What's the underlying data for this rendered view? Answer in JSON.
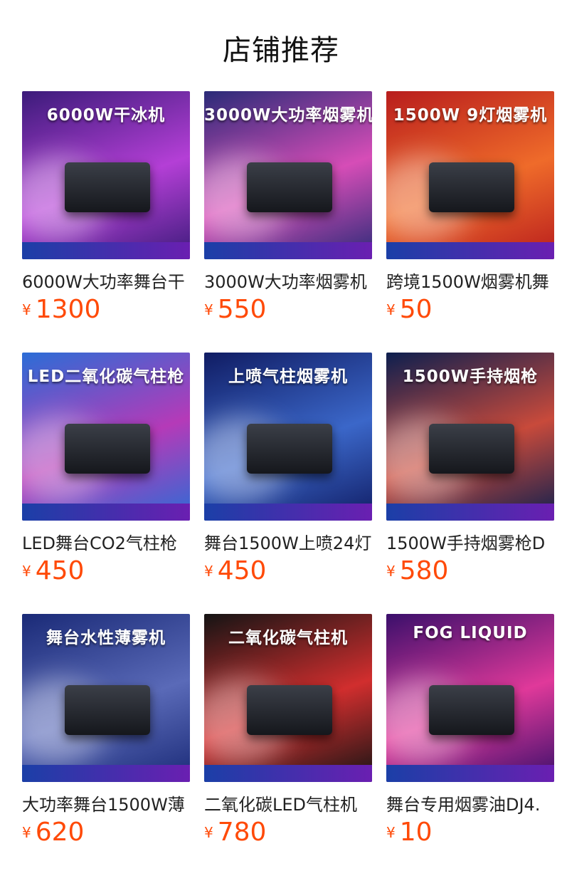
{
  "page": {
    "title": "店铺推荐"
  },
  "currency_symbol": "¥",
  "accent_color": "#ff4a08",
  "products": [
    {
      "name": "6000W大功率舞台干",
      "price": "1300",
      "image_headline": "6000W干冰机",
      "theme": [
        "#3b1b7a",
        "#b43fd6"
      ]
    },
    {
      "name": "3000W大功率烟雾机",
      "price": "550",
      "image_headline": "3000W大功率烟雾机",
      "theme": [
        "#2a2b78",
        "#d64db7"
      ]
    },
    {
      "name": "跨境1500W烟雾机舞",
      "price": "50",
      "image_headline": "1500W 9灯烟雾机",
      "theme": [
        "#b81d1d",
        "#ef6b2a"
      ]
    },
    {
      "name": "LED舞台CO2气柱枪",
      "price": "450",
      "image_headline": "LED二氧化碳气柱枪",
      "theme": [
        "#2b6dd6",
        "#b53ab8"
      ]
    },
    {
      "name": "舞台1500W上喷24灯",
      "price": "450",
      "image_headline": "上喷气柱烟雾机",
      "theme": [
        "#101c63",
        "#3b67c9"
      ]
    },
    {
      "name": "1500W手持烟雾枪D",
      "price": "580",
      "image_headline": "1500W手持烟枪",
      "theme": [
        "#0d1f4f",
        "#c84a3b"
      ]
    },
    {
      "name": "大功率舞台1500W薄",
      "price": "620",
      "image_headline": "舞台水性薄雾机",
      "theme": [
        "#1a2a77",
        "#5a6ab8"
      ]
    },
    {
      "name": "二氧化碳LED气柱机",
      "price": "780",
      "image_headline": "二氧化碳气柱机",
      "theme": [
        "#141414",
        "#d12e2e"
      ]
    },
    {
      "name": "舞台专用烟雾油DJ4.",
      "price": "10",
      "image_headline": "FOG LIQUID",
      "theme": [
        "#3a0f6b",
        "#e0399a"
      ]
    }
  ]
}
